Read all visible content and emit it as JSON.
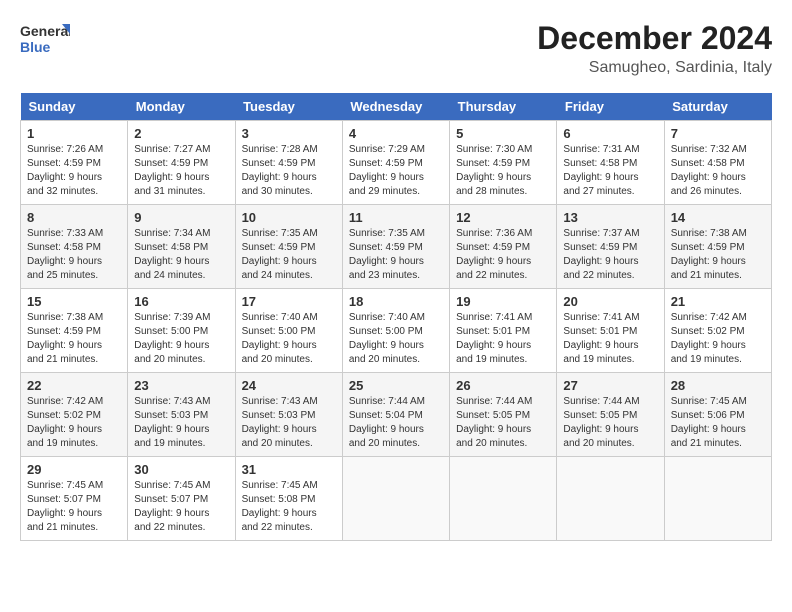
{
  "header": {
    "logo_line1": "General",
    "logo_line2": "Blue",
    "title": "December 2024",
    "subtitle": "Samugheo, Sardinia, Italy"
  },
  "weekdays": [
    "Sunday",
    "Monday",
    "Tuesday",
    "Wednesday",
    "Thursday",
    "Friday",
    "Saturday"
  ],
  "weeks": [
    [
      {
        "day": "1",
        "info": "Sunrise: 7:26 AM\nSunset: 4:59 PM\nDaylight: 9 hours\nand 32 minutes."
      },
      {
        "day": "2",
        "info": "Sunrise: 7:27 AM\nSunset: 4:59 PM\nDaylight: 9 hours\nand 31 minutes."
      },
      {
        "day": "3",
        "info": "Sunrise: 7:28 AM\nSunset: 4:59 PM\nDaylight: 9 hours\nand 30 minutes."
      },
      {
        "day": "4",
        "info": "Sunrise: 7:29 AM\nSunset: 4:59 PM\nDaylight: 9 hours\nand 29 minutes."
      },
      {
        "day": "5",
        "info": "Sunrise: 7:30 AM\nSunset: 4:59 PM\nDaylight: 9 hours\nand 28 minutes."
      },
      {
        "day": "6",
        "info": "Sunrise: 7:31 AM\nSunset: 4:58 PM\nDaylight: 9 hours\nand 27 minutes."
      },
      {
        "day": "7",
        "info": "Sunrise: 7:32 AM\nSunset: 4:58 PM\nDaylight: 9 hours\nand 26 minutes."
      }
    ],
    [
      {
        "day": "8",
        "info": "Sunrise: 7:33 AM\nSunset: 4:58 PM\nDaylight: 9 hours\nand 25 minutes."
      },
      {
        "day": "9",
        "info": "Sunrise: 7:34 AM\nSunset: 4:58 PM\nDaylight: 9 hours\nand 24 minutes."
      },
      {
        "day": "10",
        "info": "Sunrise: 7:35 AM\nSunset: 4:59 PM\nDaylight: 9 hours\nand 24 minutes."
      },
      {
        "day": "11",
        "info": "Sunrise: 7:35 AM\nSunset: 4:59 PM\nDaylight: 9 hours\nand 23 minutes."
      },
      {
        "day": "12",
        "info": "Sunrise: 7:36 AM\nSunset: 4:59 PM\nDaylight: 9 hours\nand 22 minutes."
      },
      {
        "day": "13",
        "info": "Sunrise: 7:37 AM\nSunset: 4:59 PM\nDaylight: 9 hours\nand 22 minutes."
      },
      {
        "day": "14",
        "info": "Sunrise: 7:38 AM\nSunset: 4:59 PM\nDaylight: 9 hours\nand 21 minutes."
      }
    ],
    [
      {
        "day": "15",
        "info": "Sunrise: 7:38 AM\nSunset: 4:59 PM\nDaylight: 9 hours\nand 21 minutes."
      },
      {
        "day": "16",
        "info": "Sunrise: 7:39 AM\nSunset: 5:00 PM\nDaylight: 9 hours\nand 20 minutes."
      },
      {
        "day": "17",
        "info": "Sunrise: 7:40 AM\nSunset: 5:00 PM\nDaylight: 9 hours\nand 20 minutes."
      },
      {
        "day": "18",
        "info": "Sunrise: 7:40 AM\nSunset: 5:00 PM\nDaylight: 9 hours\nand 20 minutes."
      },
      {
        "day": "19",
        "info": "Sunrise: 7:41 AM\nSunset: 5:01 PM\nDaylight: 9 hours\nand 19 minutes."
      },
      {
        "day": "20",
        "info": "Sunrise: 7:41 AM\nSunset: 5:01 PM\nDaylight: 9 hours\nand 19 minutes."
      },
      {
        "day": "21",
        "info": "Sunrise: 7:42 AM\nSunset: 5:02 PM\nDaylight: 9 hours\nand 19 minutes."
      }
    ],
    [
      {
        "day": "22",
        "info": "Sunrise: 7:42 AM\nSunset: 5:02 PM\nDaylight: 9 hours\nand 19 minutes."
      },
      {
        "day": "23",
        "info": "Sunrise: 7:43 AM\nSunset: 5:03 PM\nDaylight: 9 hours\nand 19 minutes."
      },
      {
        "day": "24",
        "info": "Sunrise: 7:43 AM\nSunset: 5:03 PM\nDaylight: 9 hours\nand 20 minutes."
      },
      {
        "day": "25",
        "info": "Sunrise: 7:44 AM\nSunset: 5:04 PM\nDaylight: 9 hours\nand 20 minutes."
      },
      {
        "day": "26",
        "info": "Sunrise: 7:44 AM\nSunset: 5:05 PM\nDaylight: 9 hours\nand 20 minutes."
      },
      {
        "day": "27",
        "info": "Sunrise: 7:44 AM\nSunset: 5:05 PM\nDaylight: 9 hours\nand 20 minutes."
      },
      {
        "day": "28",
        "info": "Sunrise: 7:45 AM\nSunset: 5:06 PM\nDaylight: 9 hours\nand 21 minutes."
      }
    ],
    [
      {
        "day": "29",
        "info": "Sunrise: 7:45 AM\nSunset: 5:07 PM\nDaylight: 9 hours\nand 21 minutes."
      },
      {
        "day": "30",
        "info": "Sunrise: 7:45 AM\nSunset: 5:07 PM\nDaylight: 9 hours\nand 22 minutes."
      },
      {
        "day": "31",
        "info": "Sunrise: 7:45 AM\nSunset: 5:08 PM\nDaylight: 9 hours\nand 22 minutes."
      },
      {
        "day": "",
        "info": ""
      },
      {
        "day": "",
        "info": ""
      },
      {
        "day": "",
        "info": ""
      },
      {
        "day": "",
        "info": ""
      }
    ]
  ]
}
